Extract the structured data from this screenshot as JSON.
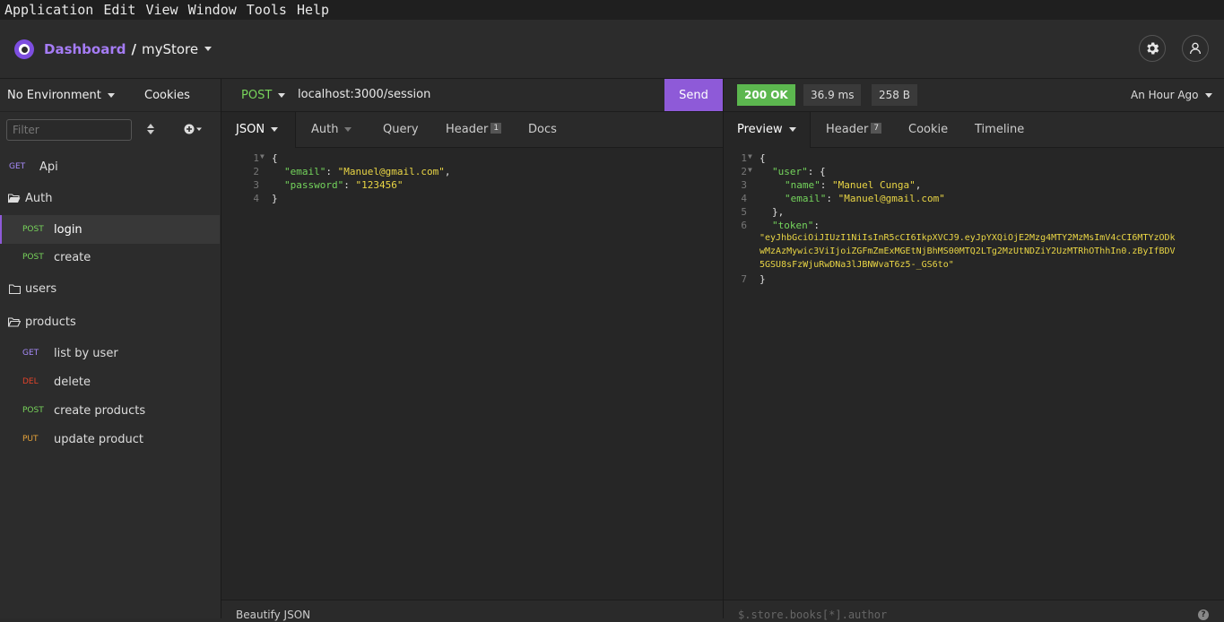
{
  "menubar": [
    "Application",
    "Edit",
    "View",
    "Window",
    "Tools",
    "Help"
  ],
  "header": {
    "dashboard": "Dashboard",
    "separator": "/",
    "workspace": "myStore"
  },
  "sidebar": {
    "environment": "No Environment",
    "cookies": "Cookies",
    "filter_placeholder": "Filter",
    "items": [
      {
        "method": "GET",
        "label": "Api"
      },
      {
        "folder": "Auth"
      },
      {
        "method": "POST",
        "label": "login"
      },
      {
        "method": "POST",
        "label": "create"
      },
      {
        "folder": "users"
      },
      {
        "folder": "products"
      },
      {
        "method": "GET",
        "label": "list by user"
      },
      {
        "method": "DEL",
        "label": "delete"
      },
      {
        "method": "POST",
        "label": "create products"
      },
      {
        "method": "PUT",
        "label": "update product"
      }
    ]
  },
  "request": {
    "method": "POST",
    "url": "localhost:3000/session",
    "send": "Send",
    "tabs": {
      "json": "JSON",
      "auth": "Auth",
      "query": "Query",
      "header": "Header",
      "header_count": "1",
      "docs": "Docs"
    },
    "body_lines": [
      "1",
      "2",
      "3",
      "4"
    ],
    "body": {
      "open": "{",
      "email_key": "\"email\"",
      "email_val": "\"Manuel@gmail.com\"",
      "password_key": "\"password\"",
      "password_val": "\"123456\"",
      "close": "}"
    },
    "beautify": "Beautify JSON"
  },
  "response": {
    "status": "200 OK",
    "time": "36.9 ms",
    "size": "258 B",
    "history": "An Hour Ago",
    "tabs": {
      "preview": "Preview",
      "header": "Header",
      "header_count": "7",
      "cookie": "Cookie",
      "timeline": "Timeline"
    },
    "lines": [
      "1",
      "2",
      "3",
      "4",
      "5",
      "6",
      "7"
    ],
    "body": {
      "open": "{",
      "user_key": "\"user\"",
      "name_key": "\"name\"",
      "name_val": "\"Manuel Cunga\"",
      "email_key": "\"email\"",
      "email_val": "\"Manuel@gmail.com\"",
      "user_close": "},",
      "token_key": "\"token\"",
      "token_l1": "\"eyJhbGciOiJIUzI1NiIsInR5cCI6IkpXVCJ9.eyJpYXQiOjE2Mzg4MTY2MzMsImV4cCI6MTYzODk",
      "token_l2": "wMzAzMywic3ViIjoiZGFmZmExMGEtNjBhMS00MTQ2LTg2MzUtNDZiY2UzMTRhOThhIn0.zByIfBDV",
      "token_l3": "5GSU8sFzWjuRwDNa3lJBNWvaT6z5-_GS6to\"",
      "close": "}"
    },
    "jsonpath_placeholder": "$.store.books[*].author"
  }
}
